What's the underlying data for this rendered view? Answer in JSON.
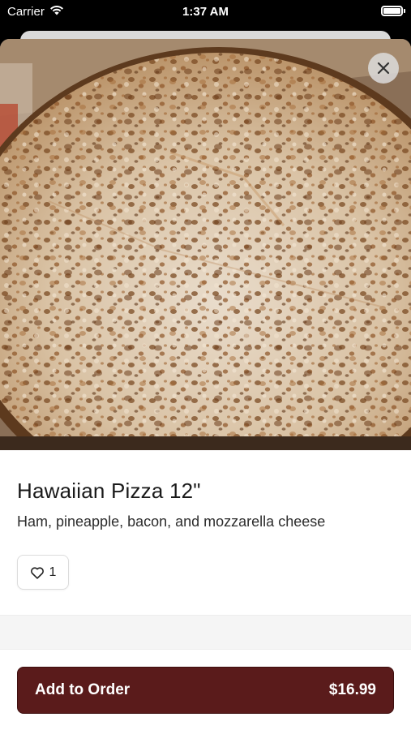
{
  "status_bar": {
    "carrier": "Carrier",
    "time": "1:37 AM",
    "wifi_icon": "wifi-icon",
    "battery_icon": "battery-icon"
  },
  "product": {
    "title": "Hawaiian Pizza 12\"",
    "description": "Ham, pineapple, bacon, and mozzarella cheese",
    "likes": "1",
    "image_icon": "pizza-photo"
  },
  "actions": {
    "close_icon": "close-icon",
    "like_icon": "heart-icon",
    "add_label": "Add to Order",
    "price": "$16.99"
  },
  "colors": {
    "button_bg": "#5a1b1b",
    "text": "#1a1a1a"
  }
}
